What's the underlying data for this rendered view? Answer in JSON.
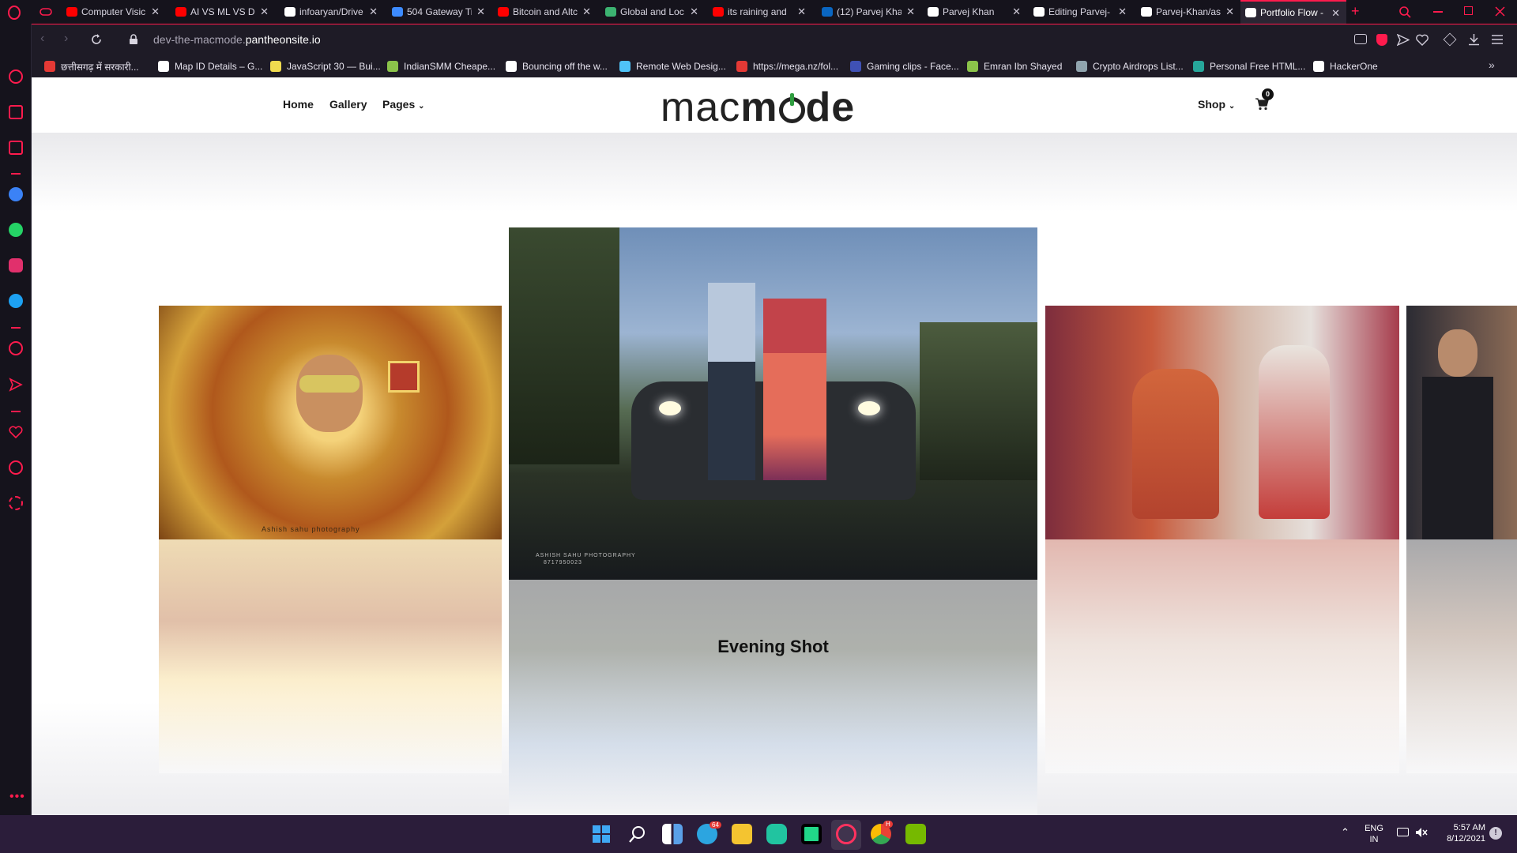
{
  "browser": {
    "tabs": [
      {
        "title": "Computer Visic",
        "color": "#ff0000"
      },
      {
        "title": "AI VS ML VS DI",
        "color": "#ff0000"
      },
      {
        "title": "infoaryan/Drive",
        "color": "#ffffff"
      },
      {
        "title": "504 Gateway Ti",
        "color": "#3d8bff"
      },
      {
        "title": "Bitcoin and Altc",
        "color": "#ff0000"
      },
      {
        "title": "Global and Loc",
        "color": "#3cb371"
      },
      {
        "title": "its raining and",
        "color": "#ff0000"
      },
      {
        "title": "(12) Parvej Kha",
        "color": "#0a66c2"
      },
      {
        "title": "Parvej Khan",
        "color": "#ffffff"
      },
      {
        "title": "Editing Parvej-",
        "color": "#ffffff"
      },
      {
        "title": "Parvej-Khan/as",
        "color": "#ffffff"
      },
      {
        "title": "Portfolio Flow -",
        "color": "#ffffff",
        "active": true
      }
    ],
    "url_prefix": "dev-the-macmode.",
    "url_domain": "pantheonsite.io",
    "bookmarks": [
      {
        "label": "छत्तीसगढ़ में सरकारी...",
        "color": "#e53935"
      },
      {
        "label": "Map ID Details – G...",
        "color": "#ffffff"
      },
      {
        "label": "JavaScript 30 — Bui...",
        "color": "#f0db4f"
      },
      {
        "label": "IndianSMM Cheape...",
        "color": "#8bc34a"
      },
      {
        "label": "Bouncing off the w...",
        "color": "#ffffff"
      },
      {
        "label": "Remote Web Desig...",
        "color": "#4fc3f7"
      },
      {
        "label": "https://mega.nz/fol...",
        "color": "#e53935"
      },
      {
        "label": "Gaming clips - Face...",
        "color": "#3f51b5"
      },
      {
        "label": "Emran Ibn Shayed",
        "color": "#8bc34a"
      },
      {
        "label": "Crypto Airdrops List...",
        "color": "#90a4ae"
      },
      {
        "label": "Personal Free HTML...",
        "color": "#26a69a"
      },
      {
        "label": "HackerOne",
        "color": "#ffffff"
      }
    ],
    "accent": "#ff1b4d"
  },
  "site": {
    "logo_left": "mac",
    "logo_right": "m",
    "logo_tail": "de",
    "nav": {
      "home": "Home",
      "gallery": "Gallery",
      "pages": "Pages",
      "shop": "Shop",
      "cart_count": "0"
    },
    "caption": "Evening Shot",
    "watermark_center": "ASHISH SAHU PHOTOGRAPHY",
    "watermark_phone": "8717950023",
    "watermark_left": "Ashish sahu photography"
  },
  "taskbar": {
    "lang_top": "ENG",
    "lang_bottom": "IN",
    "time": "5:57 AM",
    "date": "8/12/2021",
    "telegram_badge": "64",
    "chrome_badge": "H"
  }
}
